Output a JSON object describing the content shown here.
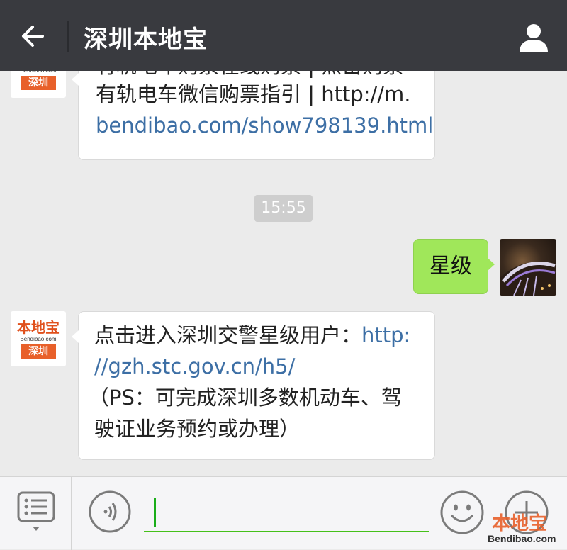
{
  "header": {
    "title": "深圳本地宝",
    "back_icon": "arrow-left-icon",
    "profile_icon": "person-icon"
  },
  "brand_avatar": {
    "logo_text": "本地宝",
    "logo_url": "Bendibao.com",
    "city": "深圳"
  },
  "messages": [
    {
      "side": "left",
      "lines": [
        "有轨电车购票在线购票 | 点击购票",
        "有轨电车微信购票指引 | http://m.",
        "bendibao.com/show798139.html"
      ]
    },
    {
      "type": "timestamp",
      "text": "15:55"
    },
    {
      "side": "right",
      "text": "星级"
    },
    {
      "side": "left",
      "line1_text": "点击进入深圳交警星级用户：",
      "line1_link": "http:",
      "line2_link": "//gzh.stc.gov.cn/h5/",
      "line3": "（PS：可完成深圳多数机动车、驾",
      "line4": "驶证业务预约或办理）"
    }
  ],
  "input_bar": {
    "menu_icon": "menu-list-icon",
    "voice_icon": "voice-icon",
    "emoji_icon": "emoji-icon",
    "plus_icon": "plus-icon",
    "value": ""
  },
  "watermark": {
    "logo_text": "本地宝",
    "url": "Bendibao.com"
  },
  "colors": {
    "topbar": "#393a3f",
    "chat_bg": "#ebebeb",
    "sent_bubble": "#a0e75a",
    "link": "#3d6fa5",
    "input_underline": "#45c01a"
  }
}
